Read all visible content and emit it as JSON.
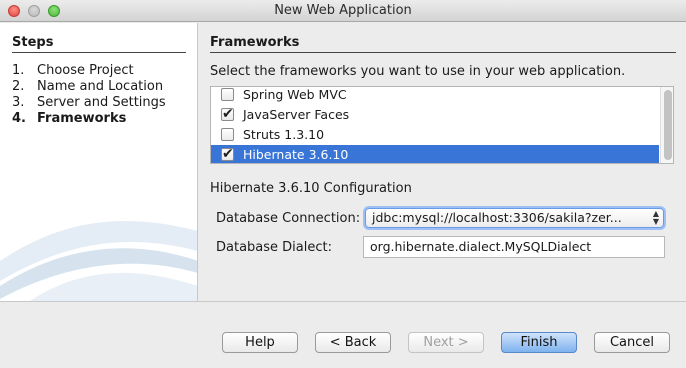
{
  "window": {
    "title": "New Web Application"
  },
  "steps": {
    "heading": "Steps",
    "items": [
      {
        "num": "1.",
        "label": "Choose Project"
      },
      {
        "num": "2.",
        "label": "Name and Location"
      },
      {
        "num": "3.",
        "label": "Server and Settings"
      },
      {
        "num": "4.",
        "label": "Frameworks",
        "current": true
      }
    ]
  },
  "frameworks": {
    "heading": "Frameworks",
    "instruction": "Select the frameworks you want to use in your web application.",
    "items": [
      {
        "label": "Spring Web MVC",
        "checked": false
      },
      {
        "label": "JavaServer Faces",
        "checked": true
      },
      {
        "label": "Struts 1.3.10",
        "checked": false
      },
      {
        "label": "Hibernate 3.6.10",
        "checked": true,
        "selected": true
      }
    ]
  },
  "config": {
    "heading": "Hibernate 3.6.10 Configuration",
    "connection_label": "Database Connection:",
    "connection_value": "jdbc:mysql://localhost:3306/sakila?zer...",
    "dialect_label": "Database Dialect:",
    "dialect_value": "org.hibernate.dialect.MySQLDialect"
  },
  "buttons": {
    "help": "Help",
    "back": "< Back",
    "next": "Next >",
    "finish": "Finish",
    "cancel": "Cancel"
  },
  "colors": {
    "selection": "#3875d7",
    "accent": "#7fb2ef"
  }
}
